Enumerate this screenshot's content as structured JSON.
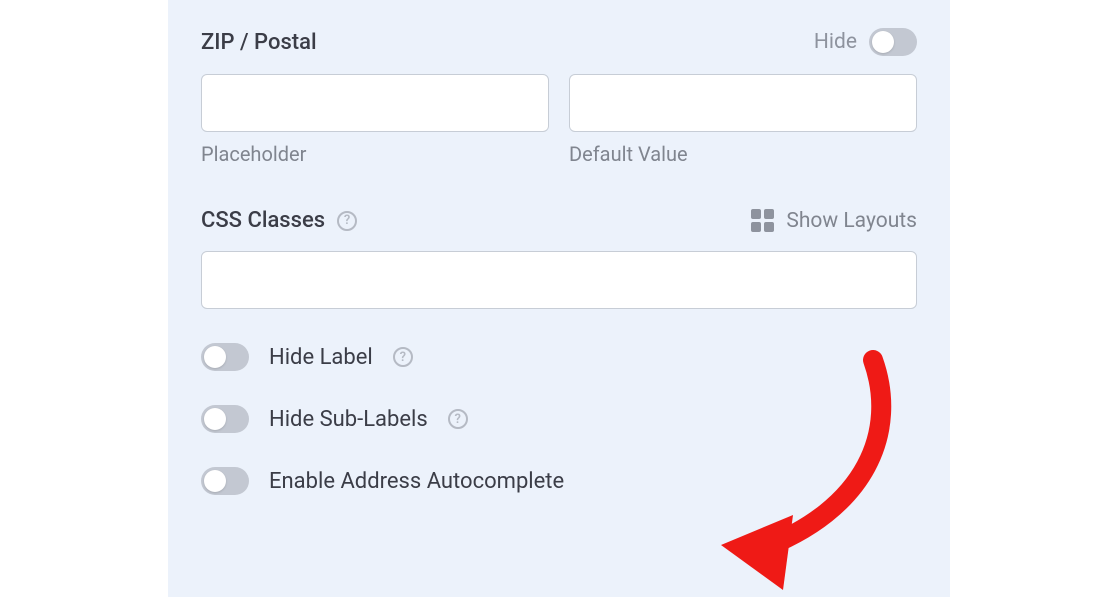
{
  "zip": {
    "title": "ZIP / Postal",
    "hide_label": "Hide",
    "placeholder_label": "Placeholder",
    "default_value_label": "Default Value"
  },
  "css": {
    "title": "CSS Classes",
    "show_layouts": "Show Layouts"
  },
  "toggles": {
    "hide_label": "Hide Label",
    "hide_sublabels": "Hide Sub-Labels",
    "enable_autocomplete": "Enable Address Autocomplete"
  }
}
